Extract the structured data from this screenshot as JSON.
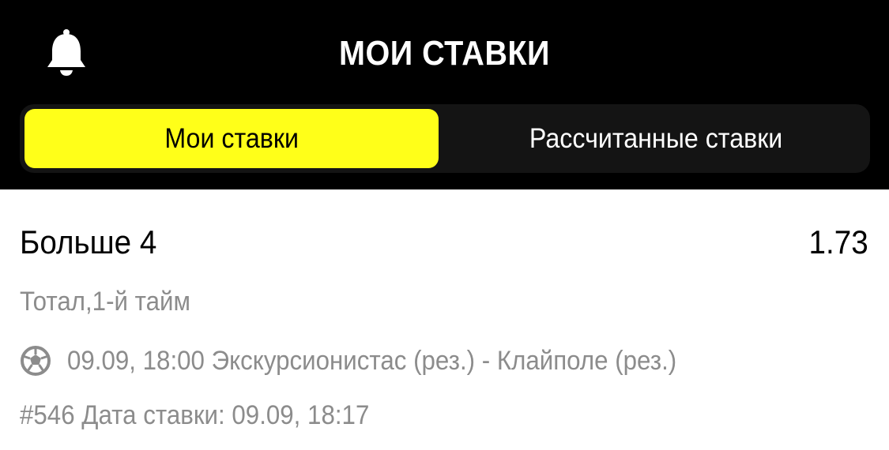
{
  "header": {
    "title": "МОИ СТАВКИ",
    "bell_icon": "bell-icon"
  },
  "tabs": [
    {
      "label": "Мои ставки",
      "active": true
    },
    {
      "label": "Рассчитанные ставки",
      "active": false
    }
  ],
  "bet": {
    "outcome": "Больше 4",
    "odds": "1.73",
    "market": "Тотал,1-й тайм",
    "sport_icon": "soccer-ball-icon",
    "event": "09.09, 18:00 Экскурсионистас (рез.) - Клайполе (рез.)",
    "meta": "#546 Дата ставки: 09.09, 18:17"
  },
  "colors": {
    "header_bg": "#000000",
    "accent": "#ffff19",
    "tab_bar_bg": "#141414",
    "secondary_text": "#8c8c8c"
  }
}
